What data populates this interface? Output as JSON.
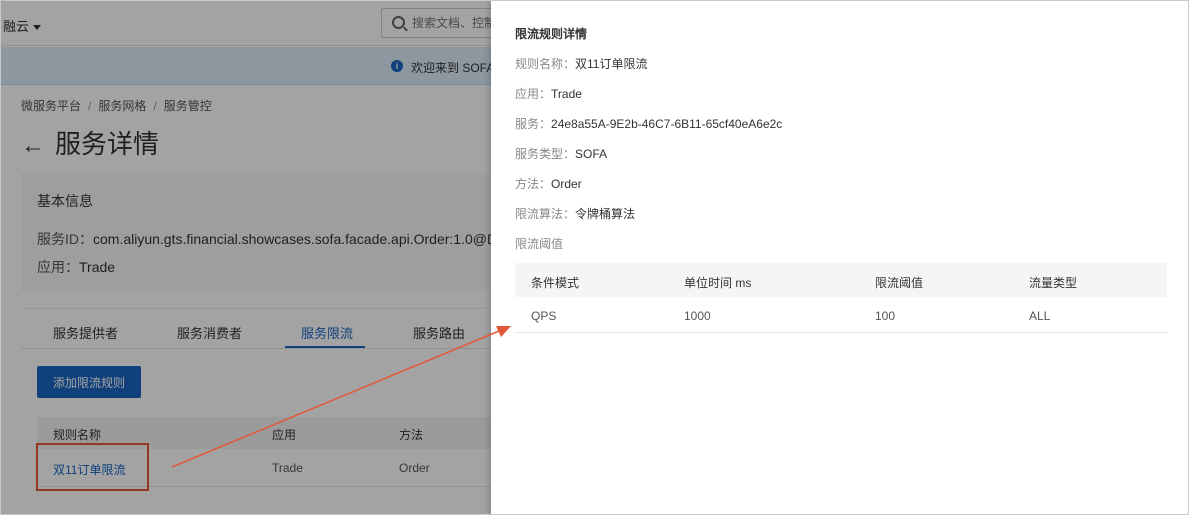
{
  "header": {
    "brand": "融云",
    "search_placeholder": "搜索文档、控制台"
  },
  "banner": {
    "text": "欢迎来到 SOFA"
  },
  "breadcrumb": [
    "微服务平台",
    "服务网格",
    "服务管控"
  ],
  "page_title": "服务详情",
  "basic_info": {
    "heading": "基本信息",
    "service_id_label": "服务ID：",
    "service_id_value": "com.aliyun.gts.financial.showcases.sofa.facade.api.Order:1.0@D",
    "app_label": "应用：",
    "app_value": "Trade"
  },
  "tabs": [
    "服务提供者",
    "服务消费者",
    "服务限流",
    "服务路由"
  ],
  "add_button": "添加限流规则",
  "rules_table": {
    "headers": [
      "规则名称",
      "应用",
      "方法"
    ],
    "rows": [
      {
        "name": "双11订单限流",
        "app": "Trade",
        "method": "Order"
      }
    ]
  },
  "drawer": {
    "title": "限流规则详情",
    "fields": [
      {
        "label": "规则名称：",
        "value": "双11订单限流"
      },
      {
        "label": "应用：",
        "value": "Trade"
      },
      {
        "label": "服务：",
        "value": "24e8a55A-9E2b-46C7-6B11-65cf40eA6e2c"
      },
      {
        "label": "服务类型：",
        "value": "SOFA"
      },
      {
        "label": "方法：",
        "value": "Order"
      },
      {
        "label": "限流算法：",
        "value": "令牌桶算法"
      },
      {
        "label": "限流阈值",
        "value": ""
      }
    ],
    "table": {
      "headers": [
        "条件模式",
        "单位时间 ms",
        "限流阈值",
        "流量类型"
      ],
      "rows": [
        {
          "mode": "QPS",
          "unit": "1000",
          "threshold": "100",
          "type": "ALL"
        }
      ]
    }
  },
  "colors": {
    "accent": "#1a66c2",
    "highlight": "#e4583a"
  }
}
